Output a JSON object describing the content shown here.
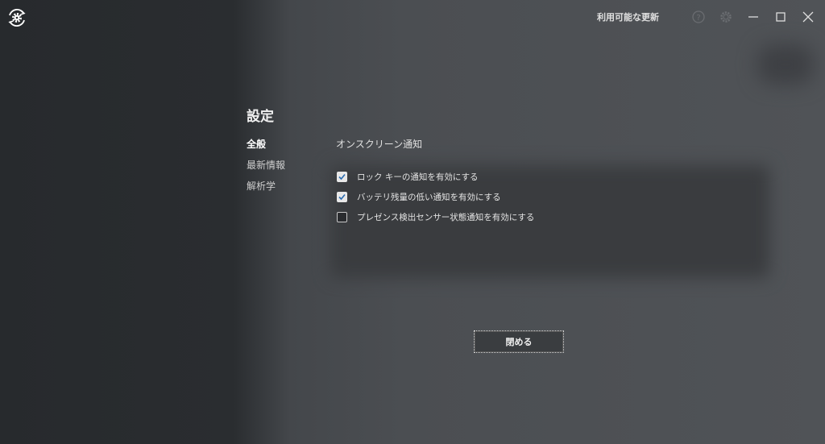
{
  "header": {
    "update_label": "利用可能な更新",
    "icons": [
      "app-logo-icon",
      "help-icon",
      "settings-icon",
      "minimize-icon",
      "maximize-icon",
      "close-icon"
    ]
  },
  "settings": {
    "title": "設定",
    "nav": [
      {
        "label": "全般",
        "active": true
      },
      {
        "label": "最新情報",
        "active": false
      },
      {
        "label": "解析学",
        "active": false
      }
    ],
    "section_title": "オンスクリーン通知",
    "options": [
      {
        "label": "ロック キーの通知を有効にする",
        "checked": true
      },
      {
        "label": "バッテリ残量の低い通知を有効にする",
        "checked": true
      },
      {
        "label": "プレゼンス検出センサー状態通知を有効にする",
        "checked": false
      }
    ],
    "close_label": "閉める"
  },
  "colors": {
    "checkbox_check": "#2b6cb0"
  }
}
